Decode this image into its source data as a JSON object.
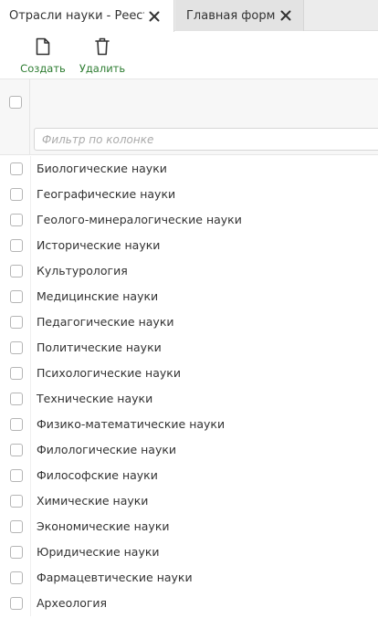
{
  "tabs": [
    {
      "label": "Отрасли науки - Реестр",
      "active": true
    },
    {
      "label": "Главная форма",
      "active": false
    }
  ],
  "toolbar": {
    "create_label": "Создать",
    "delete_label": "Удалить",
    "label_color": "#2e7d32"
  },
  "grid": {
    "filter_placeholder": "Фильтр по колонке",
    "rows": [
      "Биологические науки",
      "Географические науки",
      "Геолого-минералогические науки",
      "Исторические науки",
      "Культурология",
      "Медицинские науки",
      "Педагогические науки",
      "Политические науки",
      "Психологические науки",
      "Технические науки",
      "Физико-математические науки",
      "Филологические науки",
      "Философские науки",
      "Химические науки",
      "Экономические науки",
      "Юридические науки",
      "Фармацевтические науки",
      "Археология"
    ]
  }
}
